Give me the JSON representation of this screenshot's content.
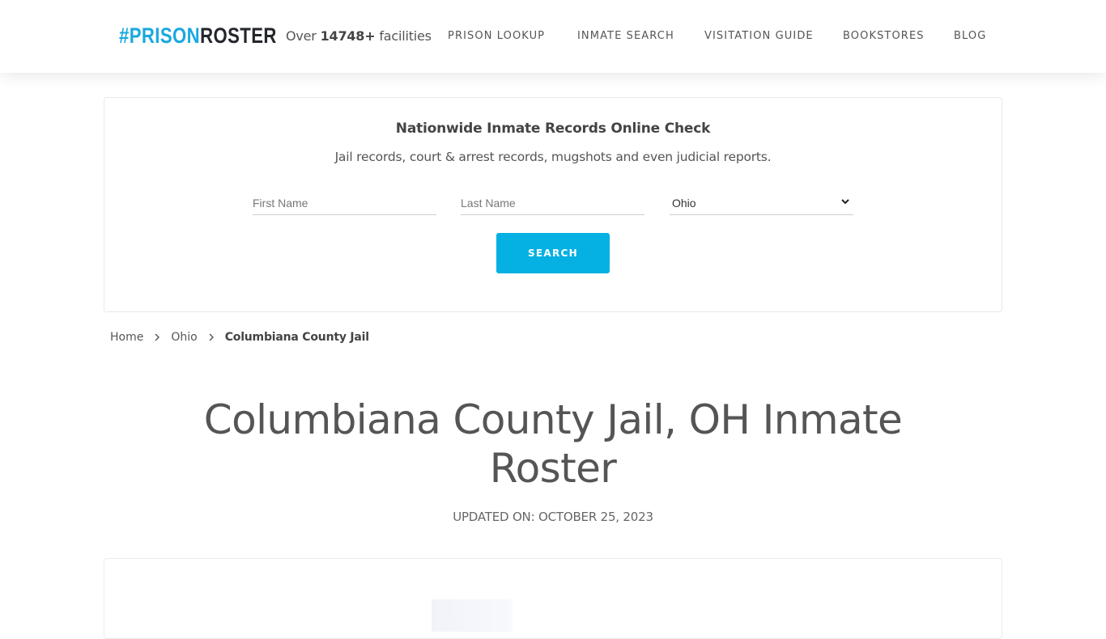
{
  "header": {
    "logo": {
      "hash_part": "#PRISON",
      "dark_part": "ROSTER"
    },
    "facility_count": {
      "prefix": "Over",
      "count": "14748+",
      "suffix": "facilities"
    },
    "nav": [
      {
        "label": "PRISON LOOKUP"
      },
      {
        "label": "INMATE SEARCH"
      },
      {
        "label": "VISITATION GUIDE"
      },
      {
        "label": "BOOKSTORES"
      },
      {
        "label": "BLOG"
      }
    ]
  },
  "search": {
    "title": "Nationwide Inmate Records Online Check",
    "subtitle": "Jail records, court & arrest records, mugshots and even judicial reports.",
    "first_name": {
      "placeholder": "First Name",
      "value": ""
    },
    "last_name": {
      "placeholder": "Last Name",
      "value": ""
    },
    "state": {
      "selected": "Ohio"
    },
    "button_label": "SEARCH"
  },
  "breadcrumb": [
    {
      "label": "Home"
    },
    {
      "label": "Ohio"
    },
    {
      "label": "Columbiana County Jail"
    }
  ],
  "page": {
    "title": "Columbiana County Jail, OH Inmate Roster",
    "updated": "UPDATED ON: OCTOBER 25, 2023"
  },
  "colors": {
    "brand_blue": "#1aa8e0",
    "button_blue": "#05b1e2",
    "logo_dark": "#23262b"
  }
}
